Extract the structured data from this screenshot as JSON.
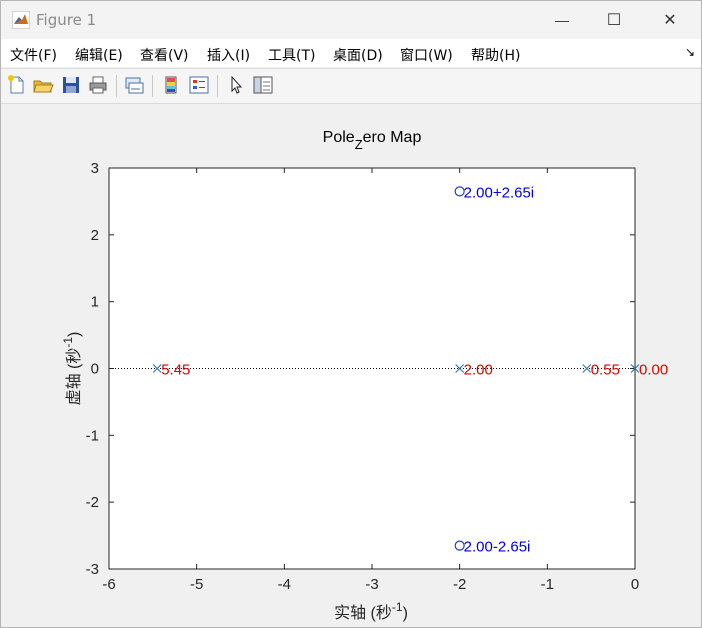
{
  "window": {
    "title": "Figure 1",
    "minimize_glyph": "—",
    "maximize_glyph": "☐",
    "close_glyph": "✕"
  },
  "menu": {
    "items": [
      {
        "label": "文件(F)"
      },
      {
        "label": "编辑(E)"
      },
      {
        "label": "查看(V)"
      },
      {
        "label": "插入(I)"
      },
      {
        "label": "工具(T)"
      },
      {
        "label": "桌面(D)"
      },
      {
        "label": "窗口(W)"
      },
      {
        "label": "帮助(H)"
      }
    ],
    "dock_arrow": "↘"
  },
  "toolbar": {
    "icons": [
      "new-figure-icon",
      "open-file-icon",
      "save-icon",
      "print-icon",
      "link-plot-icon",
      "colorbar-icon",
      "legend-icon",
      "pointer-icon",
      "property-editor-icon"
    ]
  },
  "colors": {
    "pole": "#2a7fb0",
    "zero": "#1f3fbf",
    "pole_label": "#e00000",
    "zero_label": "#0000dd",
    "axis": "#262626",
    "grid_dots": "#000000"
  },
  "chart_data": {
    "type": "scatter",
    "title_main": "Pole",
    "title_sub": "Z",
    "title_rest": "ero Map",
    "xlabel_text": "实轴 (秒",
    "xlabel_sup": "-1",
    "xlabel_close": ")",
    "ylabel_text": "虚轴 (秒",
    "ylabel_sup": "-1",
    "ylabel_close": ")",
    "xlim": [
      -6,
      0
    ],
    "ylim": [
      -3,
      3
    ],
    "xticks": [
      -6,
      -5,
      -4,
      -3,
      -2,
      -1,
      0
    ],
    "yticks": [
      -3,
      -2,
      -1,
      0,
      1,
      2,
      3
    ],
    "grid": false,
    "poles": [
      {
        "re": -5.45,
        "im": 0,
        "label": "5.45"
      },
      {
        "re": -2.0,
        "im": 0,
        "label": "2.00"
      },
      {
        "re": -0.55,
        "im": 0,
        "label": "0.55"
      },
      {
        "re": 0.0,
        "im": 0,
        "label": "0.00"
      }
    ],
    "zeros": [
      {
        "re": -2.0,
        "im": 2.65,
        "label": "2.00+2.65i"
      },
      {
        "re": -2.0,
        "im": -2.65,
        "label": "2.00-2.65i"
      }
    ]
  }
}
